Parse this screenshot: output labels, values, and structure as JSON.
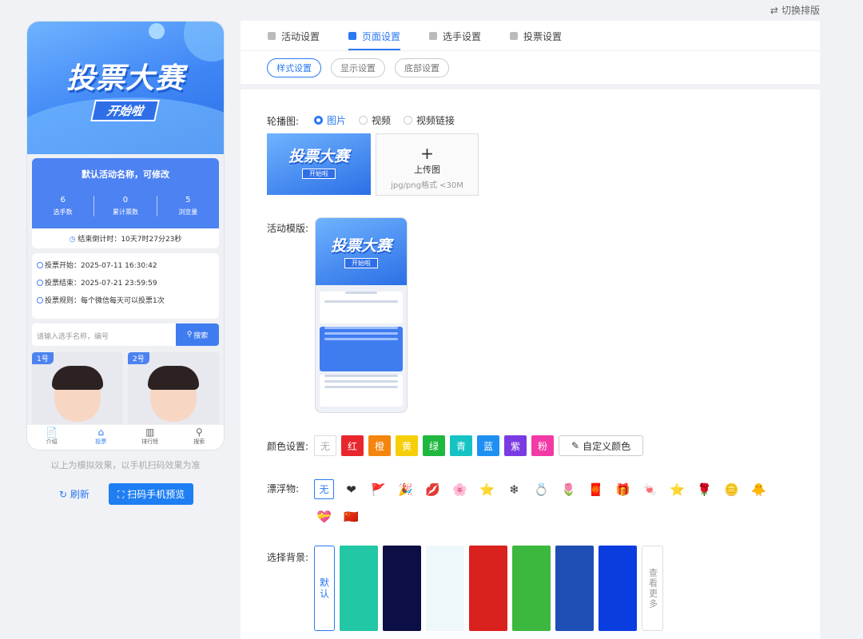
{
  "switch_label": "切换排版",
  "phone": {
    "banner_title": "投票大赛",
    "banner_sub": "开始啦",
    "activity_name": "默认活动名称，可修改",
    "stats": [
      {
        "num": "6",
        "label": "选手数"
      },
      {
        "num": "0",
        "label": "累计票数"
      },
      {
        "num": "5",
        "label": "浏览量"
      }
    ],
    "countdown": "结束倒计时：10天7时27分23秒",
    "info": [
      "投票开始：2025-07-11 16:30:42",
      "投票结束：2025-07-21 23:59:59",
      "投票规则：每个微信每天可以投票1次"
    ],
    "search_placeholder": "请输入选手名称，编号",
    "search_btn": "搜索",
    "cards": [
      "1号",
      "2号"
    ],
    "tabbar": [
      {
        "icon": "📄",
        "label": "介绍"
      },
      {
        "icon": "⌂",
        "label": "投票"
      },
      {
        "icon": "▥",
        "label": "排行榜"
      },
      {
        "icon": "⚲",
        "label": "搜索"
      }
    ]
  },
  "phone_tip": "以上为模拟效果，以手机扫码效果为准",
  "refresh_label": "刷新",
  "scan_label": "扫码手机预览",
  "main_tabs": [
    "活动设置",
    "页面设置",
    "选手设置",
    "投票设置"
  ],
  "sub_tabs": [
    "样式设置",
    "显示设置",
    "底部设置"
  ],
  "carousel": {
    "label": "轮播图:",
    "options": [
      "图片",
      "视频",
      "视频链接"
    ],
    "upload_title": "上传图",
    "upload_hint": "jpg/png格式 <30M"
  },
  "template_label": "活动模版:",
  "color_label": "颜色设置:",
  "colors": [
    {
      "name": "无",
      "hex": "#ffffff"
    },
    {
      "name": "红",
      "hex": "#e8262d"
    },
    {
      "name": "橙",
      "hex": "#f4860e"
    },
    {
      "name": "黄",
      "hex": "#f6cf0a"
    },
    {
      "name": "绿",
      "hex": "#1fb83f"
    },
    {
      "name": "青",
      "hex": "#15c3c4"
    },
    {
      "name": "蓝",
      "hex": "#1f8ff2"
    },
    {
      "name": "紫",
      "hex": "#7b3be2"
    },
    {
      "name": "粉",
      "hex": "#f23aa6"
    }
  ],
  "custom_color": "自定义颜色",
  "float_label": "漂浮物:",
  "floats": [
    "无",
    "❤",
    "🚩",
    "🎉",
    "💋",
    "🌸",
    "⭐",
    "❄",
    "💍",
    "🌷",
    "🧧",
    "🎁",
    "🍬",
    "⭐",
    "🌹",
    "🪙",
    "🐥",
    "💝",
    "🇨🇳"
  ],
  "bg_label": "选择背景:",
  "bg_default": "默认",
  "bg_more": "查看更多",
  "backgrounds": [
    "#22c7a6",
    "#0b0f46",
    "#eef8fa",
    "#d9211d",
    "#3db83f",
    "#1f4fb4",
    "#0a3de0"
  ]
}
